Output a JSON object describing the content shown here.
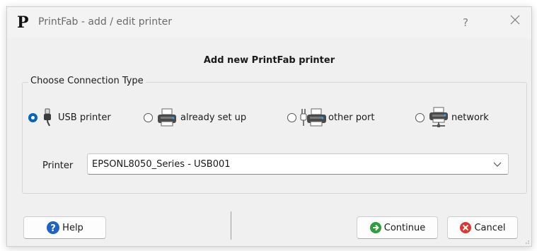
{
  "window": {
    "title": "PrintFab - add / edit printer",
    "logo": "P",
    "help_glyph": "?"
  },
  "heading": "Add new PrintFab printer",
  "group": {
    "title": "Choose Connection Type",
    "options": [
      {
        "label": "USB printer",
        "selected": true,
        "icon": "usb-plug-icon"
      },
      {
        "label": "already set up",
        "selected": false,
        "icon": "printer-icon"
      },
      {
        "label": "other port",
        "selected": false,
        "icon": "port-printer-icon"
      },
      {
        "label": "network",
        "selected": false,
        "icon": "network-printer-icon"
      }
    ]
  },
  "printer": {
    "label": "Printer",
    "value": "EPSONL8050_Series - USB001"
  },
  "buttons": {
    "help": "Help",
    "continue": "Continue",
    "cancel": "Cancel"
  },
  "colors": {
    "accent": "#0067c0",
    "continue_icon": "#2e9e3a",
    "cancel_icon": "#e0362c",
    "help_icon": "#1e63c4"
  }
}
